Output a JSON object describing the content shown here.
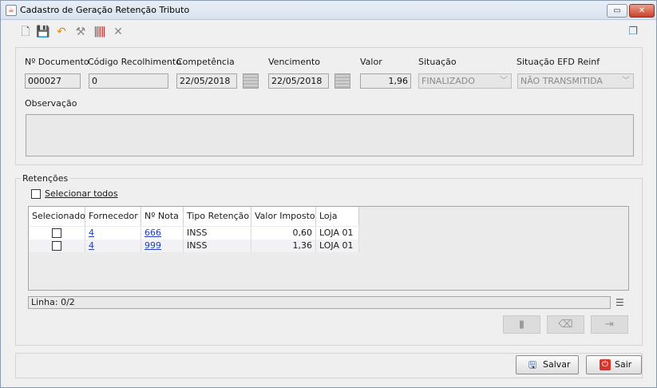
{
  "window": {
    "title": "Cadastro de Geração Retenção Tributo",
    "app_icon": "java-icon",
    "restore_glyph": "▭",
    "close_glyph": "✕"
  },
  "toolbar": {
    "new_glyph": "🗋",
    "save_glyph": "💾",
    "undo_glyph": "↶",
    "tool_glyph": "⚒",
    "barcode_glyph": "‖‖‖",
    "delete_glyph": "✕",
    "windows_glyph": "❐"
  },
  "form": {
    "documento": {
      "label": "Nº Documento",
      "value": "000027"
    },
    "codigo": {
      "label": "Código Recolhimento",
      "value": "0"
    },
    "competencia": {
      "label": "Competência",
      "value": "22/05/2018"
    },
    "vencimento": {
      "label": "Vencimento",
      "value": "22/05/2018"
    },
    "valor": {
      "label": "Valor",
      "value": "1,96"
    },
    "situacao": {
      "label": "Situação",
      "value": "FINALIZADO"
    },
    "situacao_efd": {
      "label": "Situação EFD Reinf",
      "value": "NÃO TRANSMITIDA"
    },
    "observacao": {
      "label": "Observação",
      "value": ""
    }
  },
  "retencoes": {
    "title": "Retenções",
    "select_all": "Selecionar todos",
    "columns": [
      "Selecionado",
      "Fornecedor",
      "Nº Nota",
      "Tipo Retenção",
      "Valor Imposto",
      "Loja"
    ],
    "rows": [
      {
        "fornecedor": "4",
        "nota": "666",
        "tipo": "INSS",
        "valor": "0,60",
        "loja": "LOJA 01"
      },
      {
        "fornecedor": "4",
        "nota": "999",
        "tipo": "INSS",
        "valor": "1,36",
        "loja": "LOJA 01"
      }
    ],
    "status": "Linha: 0/2",
    "menu_glyph": "☰"
  },
  "footer": {
    "save_label": "Salvar",
    "exit_label": "Sair"
  },
  "colors": {
    "link": "#1a3fc4",
    "close_button": "#c8402a",
    "exit_icon": "#d9342b"
  }
}
